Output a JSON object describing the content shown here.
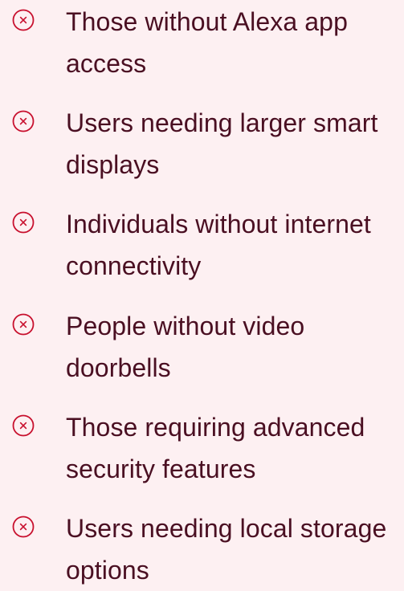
{
  "theme": {
    "background": "#fdf0f2",
    "text_color": "#4a0f22",
    "icon_color": "#c8102e"
  },
  "items": [
    {
      "icon": "circle-x-icon",
      "label": "Those without Alexa app access"
    },
    {
      "icon": "circle-x-icon",
      "label": "Users needing larger smart displays"
    },
    {
      "icon": "circle-x-icon",
      "label": "Individuals without internet connectivity"
    },
    {
      "icon": "circle-x-icon",
      "label": "People without video doorbells"
    },
    {
      "icon": "circle-x-icon",
      "label": "Those requiring advanced security features"
    },
    {
      "icon": "circle-x-icon",
      "label": "Users needing local storage options"
    }
  ]
}
